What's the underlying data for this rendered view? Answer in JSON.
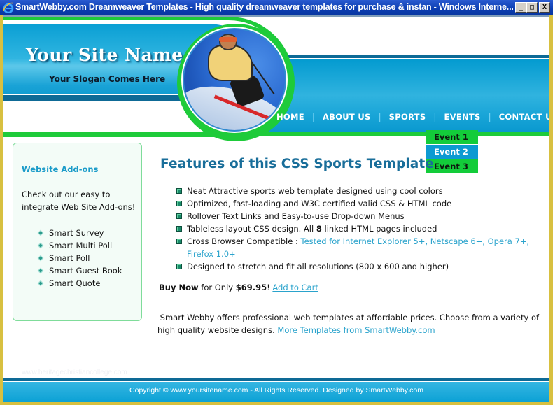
{
  "window": {
    "title": "SmartWebby.com Dreamweaver Templates - High quality dreamweaver templates for purchase & instan - Windows Interne...",
    "controls": {
      "minimize": "_",
      "maximize": "□",
      "close": "X"
    }
  },
  "header": {
    "site_name": "Your Site Name",
    "slogan": "Your Slogan Comes Here"
  },
  "nav": {
    "items": [
      {
        "label": "HOME"
      },
      {
        "label": "ABOUT US"
      },
      {
        "label": "SPORTS"
      },
      {
        "label": "EVENTS"
      },
      {
        "label": "CONTACT US"
      }
    ],
    "separator": "|",
    "events_dropdown": [
      {
        "label": "Event 1",
        "state": "normal"
      },
      {
        "label": "Event 2",
        "state": "hover"
      },
      {
        "label": "Event 3",
        "state": "normal"
      }
    ]
  },
  "sidebar": {
    "title": "Website Add-ons",
    "text": "Check out our easy to integrate Web Site Add-ons!",
    "items": [
      {
        "label": "Smart Survey"
      },
      {
        "label": "Smart Multi Poll"
      },
      {
        "label": "Smart Poll"
      },
      {
        "label": "Smart Guest Book"
      },
      {
        "label": "Smart Quote"
      }
    ]
  },
  "main": {
    "title": "Features of this CSS Sports Template",
    "features": [
      {
        "text": "Neat Attractive sports web template designed using cool colors"
      },
      {
        "text": "Optimized, fast-loading and W3C certified valid CSS & HTML code"
      },
      {
        "text": "Rollover Text Links and Easy-to-use Drop-down Menus"
      },
      {
        "pre": "Tableless layout CSS design. All ",
        "bold": "8",
        "post": " linked HTML pages included"
      },
      {
        "pre": "Cross Browser Compatible : ",
        "link": "Tested for Internet Explorer 5+, Netscape 6+, Opera 7+, Firefox 1.0+"
      },
      {
        "text": "Designed to stretch and fit all resolutions (800 x 600 and higher)"
      }
    ],
    "buy": {
      "label": "Buy Now",
      "mid": " for Only ",
      "price": "$69.95",
      "bang": "! ",
      "cart_link": "Add to Cart"
    },
    "about": {
      "text": "Smart Webby offers professional web templates at affordable prices. Choose from a variety of high quality website designs. ",
      "link": "More Templates from SmartWebby.com"
    }
  },
  "watermark": "www.heritagechristiancollege.com",
  "footer": {
    "text": "Copyright © www.yoursitename.com - All Rights Reserved. Designed by SmartWebby.com"
  },
  "colors": {
    "accent_blue": "#0a9fd4",
    "accent_green": "#1ecb3a",
    "title_blue": "#196e9a",
    "link_teal": "#2aa3cc"
  }
}
